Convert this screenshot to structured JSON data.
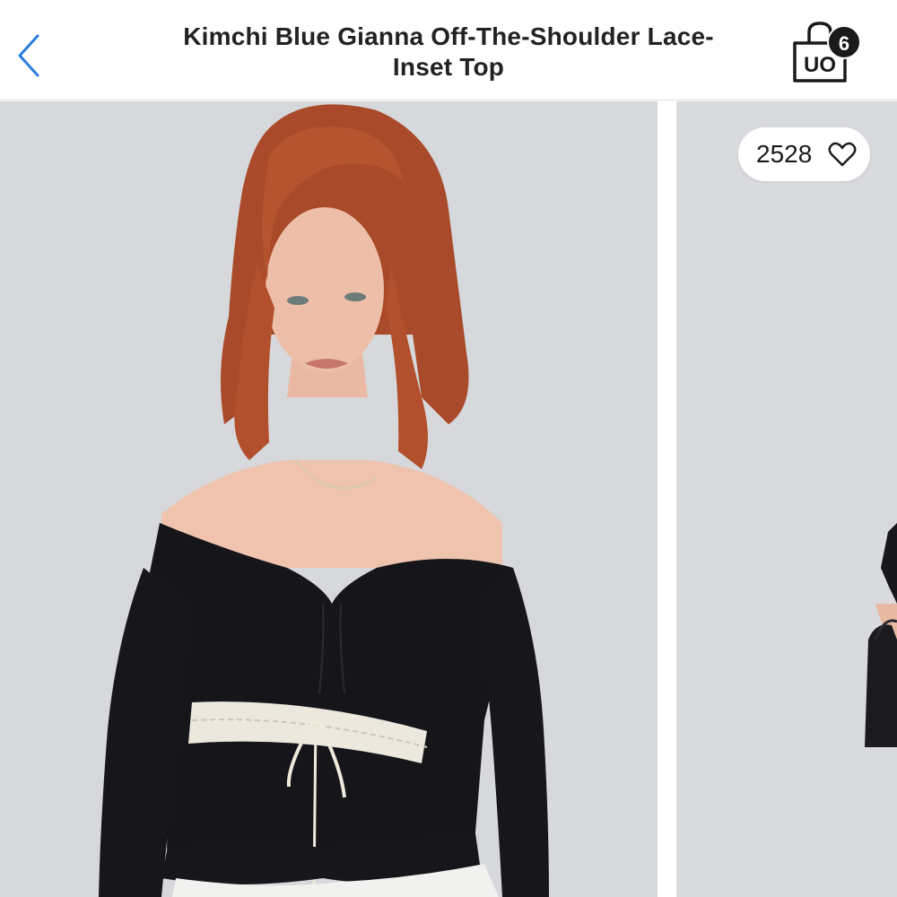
{
  "header": {
    "back_icon": "chevron-left-icon",
    "title_line1": "Kimchi Blue Gianna Off-The-Shoulder Lace-",
    "title_line2": "Inset Top",
    "bag_icon": "shopping-bag-icon",
    "bag_logo": "UO",
    "bag_count": "6"
  },
  "gallery": {
    "main_image": "model-wearing-black-off-shoulder-top-with-white-lace-inset-and-white-satin-skirt",
    "next_image": "model-holding-black-handbag",
    "likes": {
      "count": "2528",
      "icon": "heart-outline-icon"
    }
  },
  "colors": {
    "accent": "#2a7de1",
    "text": "#222222",
    "photo_background": "#d6d8db",
    "top": "#16161a",
    "lace": "#ece8dd",
    "hair": "#b2512e",
    "skirt": "#f1f1ef"
  }
}
